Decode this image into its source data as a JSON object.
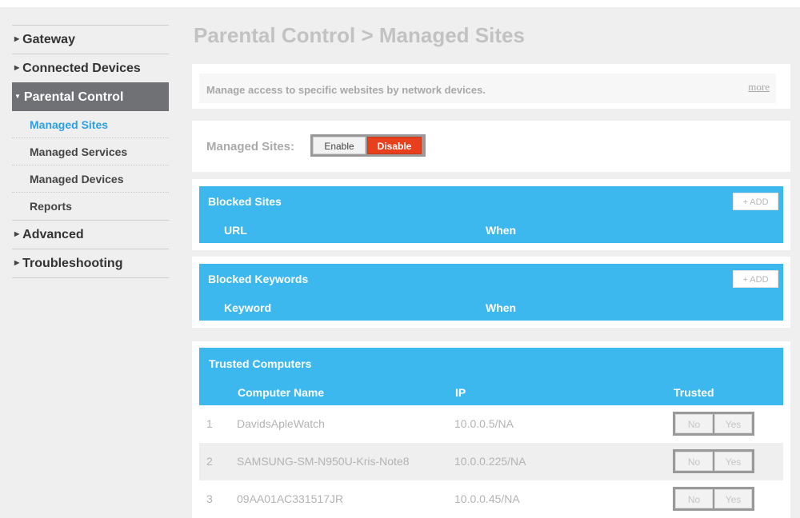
{
  "nav": {
    "gateway": "Gateway",
    "connected_devices": "Connected Devices",
    "parental_control": "Parental Control",
    "sub_items": [
      "Managed Sites",
      "Managed Services",
      "Managed Devices",
      "Reports"
    ],
    "advanced": "Advanced",
    "troubleshooting": "Troubleshooting"
  },
  "page": {
    "title": "Parental Control > Managed Sites",
    "description": "Manage access to specific websites by network devices.",
    "more_label": "more"
  },
  "managed_sites": {
    "label": "Managed Sites:",
    "enable_label": "Enable",
    "disable_label": "Disable",
    "selected": "Disable"
  },
  "blocked_sites": {
    "title": "Blocked Sites",
    "add_label": "+ ADD",
    "columns": [
      "URL",
      "When"
    ]
  },
  "blocked_keywords": {
    "title": "Blocked Keywords",
    "add_label": "+ ADD",
    "columns": [
      "Keyword",
      "When"
    ]
  },
  "trusted_computers": {
    "title": "Trusted Computers",
    "columns": [
      "Computer Name",
      "IP",
      "Trusted"
    ],
    "no_label": "No",
    "yes_label": "Yes",
    "rows": [
      {
        "num": "1",
        "name": "DavidsApleWatch",
        "ip": "10.0.0.5/NA"
      },
      {
        "num": "2",
        "name": "SAMSUNG-SM-N950U-Kris-Note8",
        "ip": "10.0.0.225/NA"
      },
      {
        "num": "3",
        "name": "09AA01AC331517JR",
        "ip": "10.0.0.45/NA"
      }
    ]
  },
  "colors": {
    "accent_blue": "#3db8ef",
    "disable_red": "#e8401d",
    "active_nav": "#6f7175",
    "current_link": "#2b9fe0"
  },
  "icons": {
    "collapsed": "triangle-right-icon",
    "expanded": "triangle-down-icon"
  }
}
